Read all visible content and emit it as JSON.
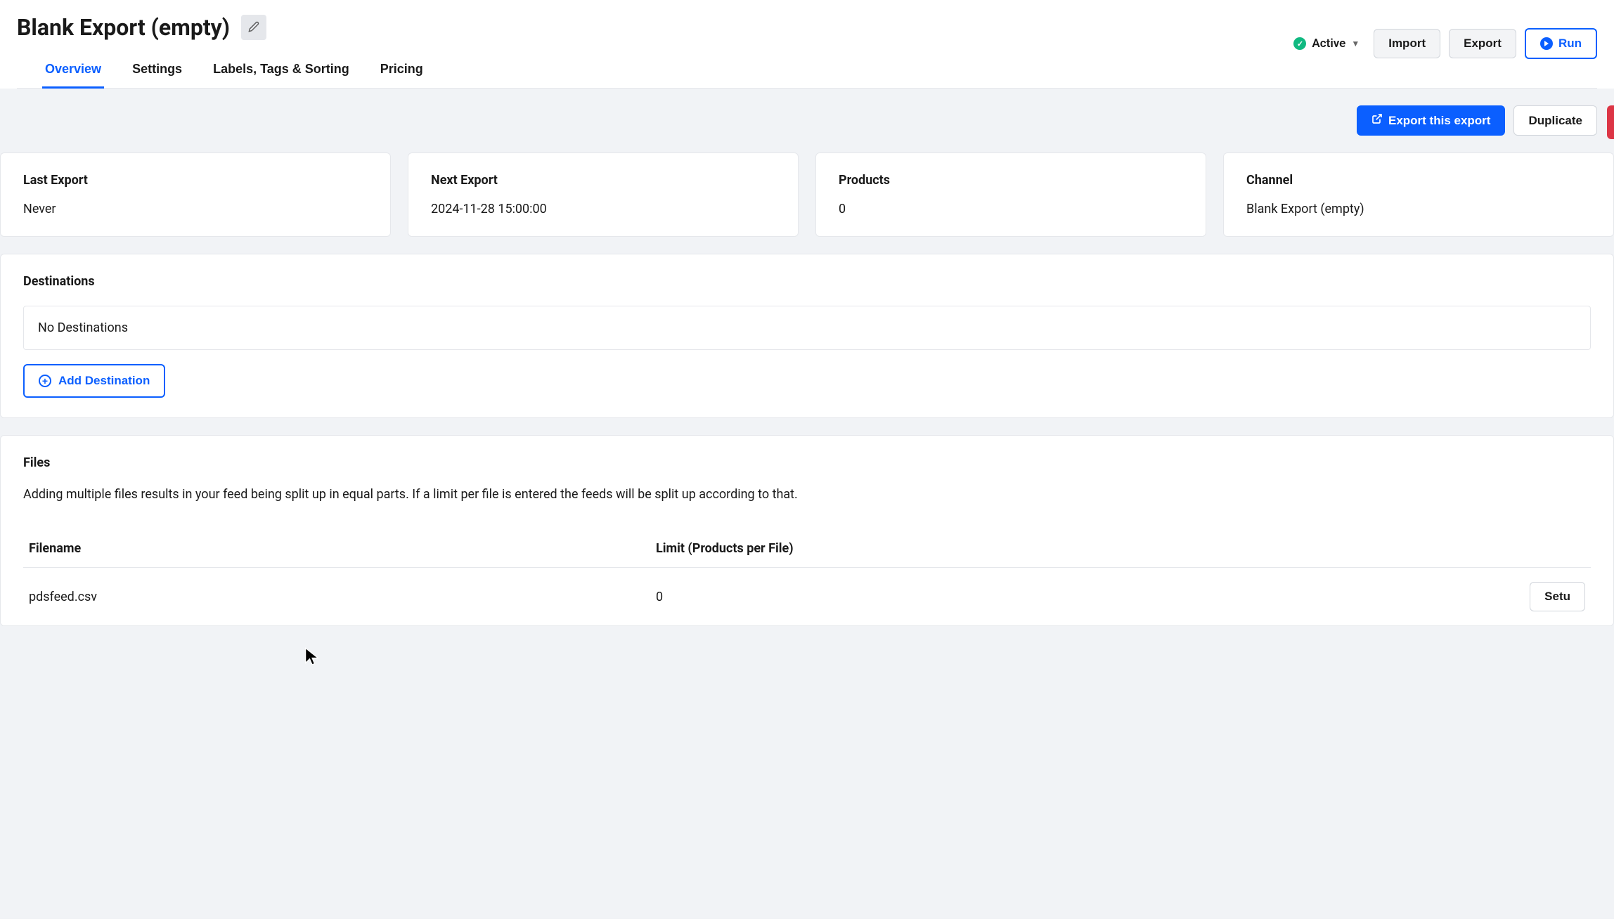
{
  "header": {
    "title": "Blank Export (empty)",
    "status": "Active",
    "import_label": "Import",
    "export_label": "Export",
    "run_label": "Run"
  },
  "tabs": [
    {
      "label": "Overview",
      "active": true
    },
    {
      "label": "Settings",
      "active": false
    },
    {
      "label": "Labels, Tags & Sorting",
      "active": false
    },
    {
      "label": "Pricing",
      "active": false
    }
  ],
  "actions": {
    "export_this": "Export this export",
    "duplicate": "Duplicate"
  },
  "stats": [
    {
      "label": "Last Export",
      "value": "Never"
    },
    {
      "label": "Next Export",
      "value": "2024-11-28 15:00:00"
    },
    {
      "label": "Products",
      "value": "0"
    },
    {
      "label": "Channel",
      "value": "Blank Export (empty)"
    }
  ],
  "destinations": {
    "title": "Destinations",
    "empty_text": "No Destinations",
    "add_label": "Add Destination"
  },
  "files": {
    "title": "Files",
    "description": "Adding multiple files results in your feed being split up in equal parts. If a limit per file is entered the feeds will be split up according to that.",
    "columns": {
      "filename": "Filename",
      "limit": "Limit (Products per File)"
    },
    "rows": [
      {
        "filename": "pdsfeed.csv",
        "limit": "0",
        "action": "Setu"
      }
    ]
  }
}
